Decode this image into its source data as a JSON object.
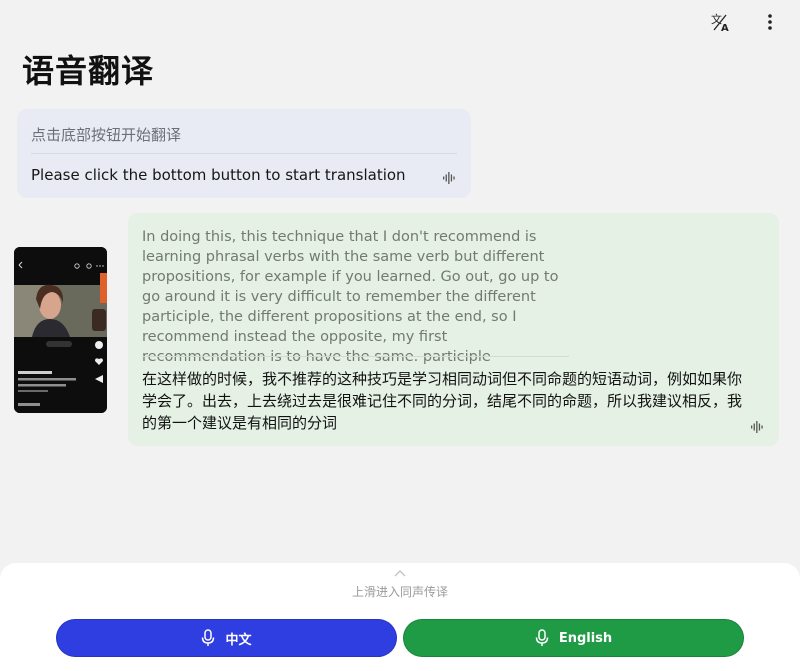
{
  "page": {
    "title": "语音翻译"
  },
  "colors": {
    "background": "#f2f2f2",
    "source_card": "#e8ebf3",
    "result_card": "#e4f1e4",
    "chinese_button": "#2f3ee0",
    "english_button": "#1f9b45"
  },
  "toolbar": {
    "icons": [
      "translate-icon",
      "more-vertical-icon"
    ]
  },
  "prompt_card": {
    "placeholder": "点击底部按钮开始翻译",
    "english_hint": "Please click the bottom button to start translation",
    "icon": "waveform-icon"
  },
  "result_card": {
    "source_text": "In doing this, this technique that I don't recommend is learning phrasal verbs with the same verb but different propositions, for example if you learned. Go out, go up to go around it is very difficult to remember the different participle, the different propositions at the end, so I recommend instead the opposite, my first recommendation is to have the same. participle",
    "translation_text": "在这样做的时候，我不推荐的这种技巧是学习相同动词但不同命题的短语动词，例如如果你学会了。出去，上去绕过去是很难记住不同的分词，结尾不同的命题，所以我建议相反，我的第一个建议是有相同的分词",
    "icon": "waveform-icon"
  },
  "thumbnail": {
    "icon": "video-thumbnail"
  },
  "bottom": {
    "swipe_hint": "上滑进入同声传译",
    "chinese_button_label": "中文",
    "english_button_label": "English",
    "button_icon": "microphone-icon"
  }
}
